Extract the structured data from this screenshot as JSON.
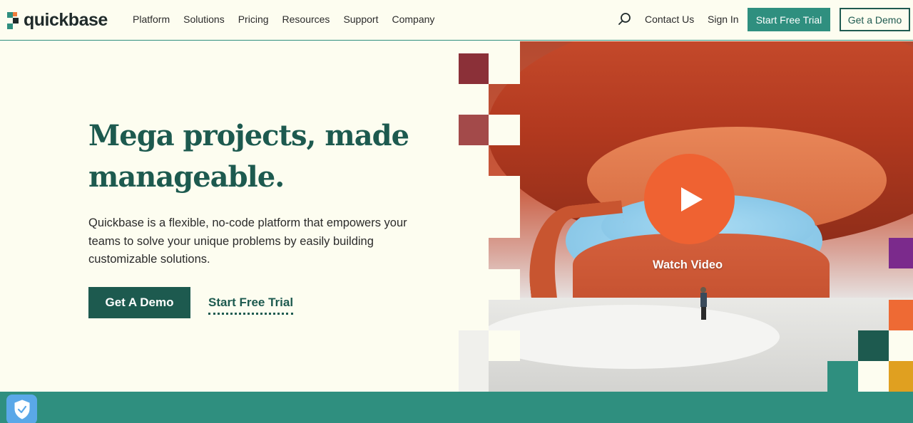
{
  "brand": {
    "name": "quickbase",
    "accent": "#2f8f7f",
    "primary": "#1d5a4f",
    "play_color": "#ef6232"
  },
  "nav": {
    "items": [
      {
        "label": "Platform"
      },
      {
        "label": "Solutions"
      },
      {
        "label": "Pricing"
      },
      {
        "label": "Resources"
      },
      {
        "label": "Support"
      },
      {
        "label": "Company"
      }
    ],
    "search_icon": "search-icon",
    "contact_label": "Contact Us",
    "signin_label": "Sign In",
    "trial_label": "Start Free Trial",
    "demo_label": "Get a Demo"
  },
  "hero": {
    "title": "Mega projects, made manageable.",
    "description": "Quickbase is a flexible, no-code platform that empowers your teams to solve your unique problems by easily building customizable solutions.",
    "primary_cta": "Get A Demo",
    "secondary_cta": "Start Free Trial",
    "video_label": "Watch Video",
    "play_icon": "play-icon"
  },
  "widgets": {
    "privacy_icon": "shield-check-icon"
  }
}
